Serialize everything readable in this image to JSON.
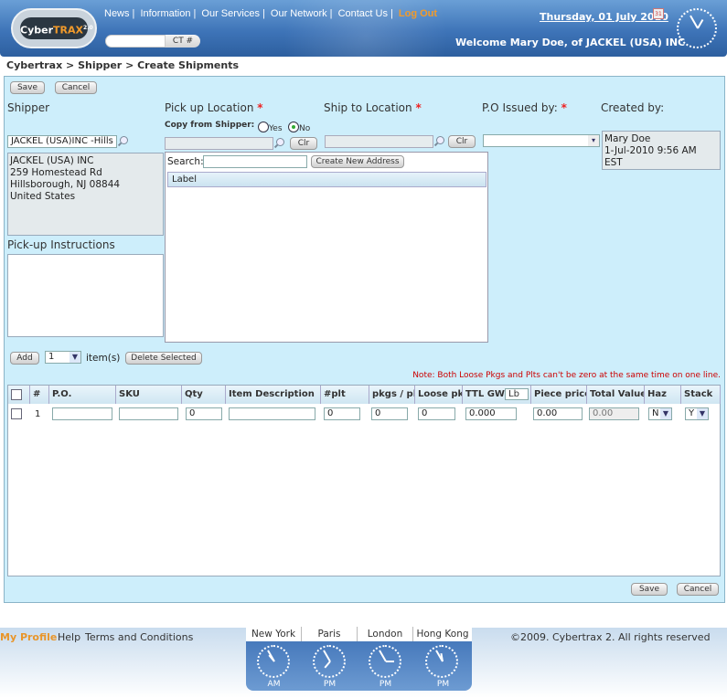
{
  "header": {
    "logo_text": "CyberTRAX 2.0",
    "nav": [
      "News",
      "Information",
      "Our Services",
      "Our Network",
      "Contact Us"
    ],
    "logout": "Log Out",
    "ct_button": "CT #",
    "date": "Thursday, 01 July 2010",
    "welcome": "Welcome Mary Doe, of JACKEL (USA) INC"
  },
  "breadcrumb": "Cybertrax > Shipper > Create Shipments",
  "toolbar": {
    "save": "Save",
    "cancel": "Cancel"
  },
  "shipper": {
    "label": "Shipper",
    "value": "JACKEL (USA)INC -Hills",
    "address": [
      "JACKEL (USA) INC",
      "259 Homestead Rd",
      "Hillsborough, NJ  08844",
      "United States"
    ],
    "instructions_label": "Pick-up Instructions"
  },
  "pickup": {
    "label": "Pick up Location",
    "required": "*",
    "copy_label": "Copy from Shipper:",
    "yes": "Yes",
    "no": "No",
    "selected": "No",
    "clr": "Clr"
  },
  "shipto": {
    "label": "Ship to Location",
    "required": "*",
    "clr": "Clr"
  },
  "po": {
    "label": "P.O Issued by:",
    "required": "*"
  },
  "created": {
    "label": "Created by:",
    "lines": [
      "Mary Doe",
      "1-Jul-2010  9:56 AM",
      "EST"
    ]
  },
  "popup": {
    "search_label": "Search:",
    "create_button": "Create New Address",
    "column": "Label"
  },
  "items": {
    "add": "Add",
    "count": "1",
    "suffix": "item(s)",
    "delete": "Delete Selected",
    "note": "Note: Both Loose Pkgs and Plts can't be zero at the same time on one line."
  },
  "table": {
    "columns": [
      "#",
      "P.O.",
      "SKU",
      "Qty",
      "Item Description",
      "#plt",
      "pkgs / plt",
      "Loose pkgs",
      "TTL GW",
      "Piece price",
      "Total Value",
      "Haz",
      "Stack"
    ],
    "weight_unit": "Lb",
    "rows": [
      {
        "num": "1",
        "po": "",
        "sku": "",
        "qty": "0",
        "desc": "",
        "plt": "0",
        "pkgs_plt": "0",
        "loose": "0",
        "ttl_gw": "0.000",
        "piece_price": "0.00",
        "total_value": "0.00",
        "haz": "N",
        "stack": "Y"
      }
    ]
  },
  "footer": {
    "my_profile": "My Profile",
    "help": "Help",
    "terms": "Terms and Conditions",
    "copyright": "©2009. Cybertrax 2. All rights reserved",
    "clocks": [
      {
        "city": "New York",
        "ampm": "AM"
      },
      {
        "city": "Paris",
        "ampm": "PM"
      },
      {
        "city": "London",
        "ampm": "PM"
      },
      {
        "city": "Hong Kong",
        "ampm": "PM"
      }
    ]
  }
}
